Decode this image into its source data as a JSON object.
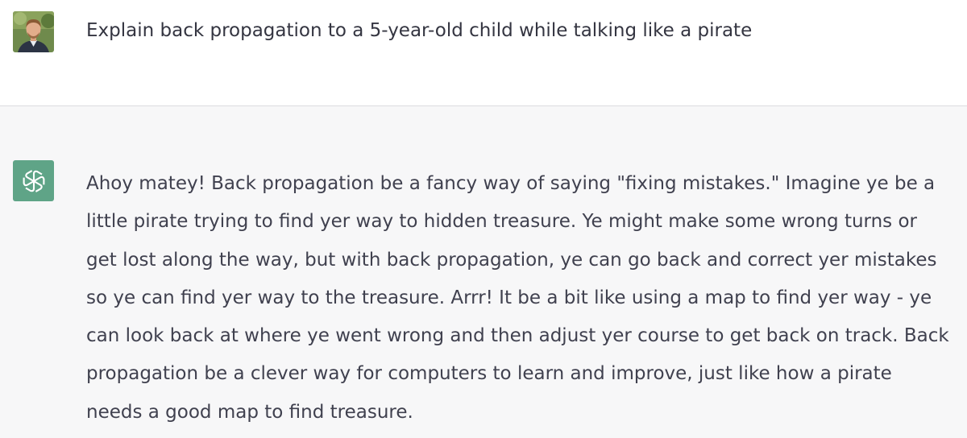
{
  "user_message": {
    "avatar_icon": "user-photo-avatar",
    "text": "Explain back propagation to a 5-year-old child while talking like a pirate"
  },
  "assistant_message": {
    "avatar_icon": "openai-logo-icon",
    "avatar_color": "#5fa487",
    "lines": [
      "Ahoy matey! Back propagation be a fancy way of saying \"fixing mistakes.\" Imagine ye be a",
      "little pirate trying to find yer way to hidden treasure. Ye might make some wrong turns or",
      "get lost along the way, but with back propagation, ye can go back and correct yer mistakes",
      "so ye can find yer way to the treasure. Arrr! It be a bit like using a map to find yer way - ye",
      "can look back at where ye went wrong and then adjust yer course to get back on track. Back",
      "propagation be a clever way for computers to learn and improve, just like how a pirate",
      "needs a good map to find treasure."
    ]
  },
  "colors": {
    "user_bg": "#ffffff",
    "assistant_bg": "#f7f7f8",
    "text": "#40414f",
    "divider": "#dcdcdf"
  }
}
